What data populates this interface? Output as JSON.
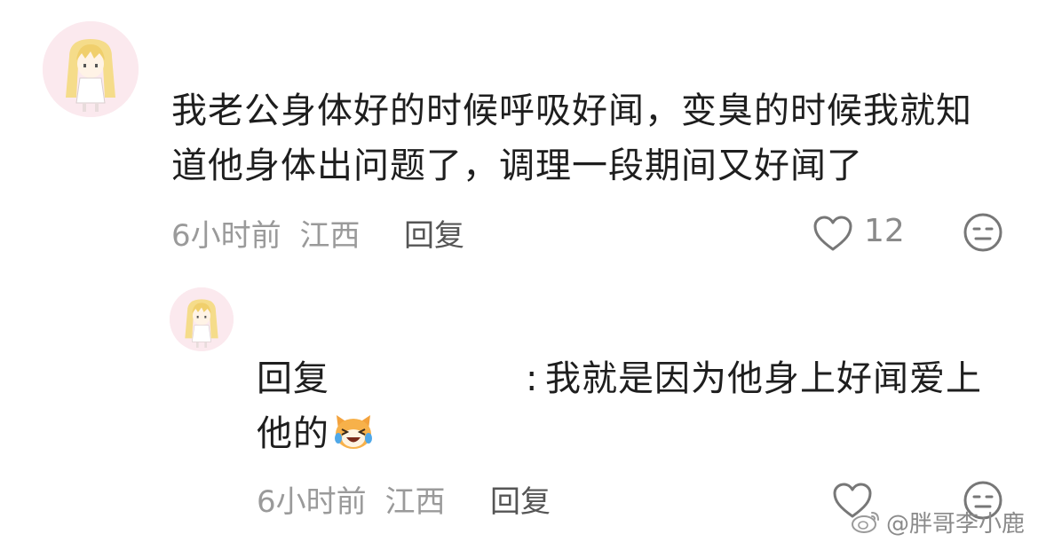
{
  "comment": {
    "text_line1": "我老公身体好的时候呼吸好闻，变臭的时候我就知",
    "text_line2": "道他身体出问题了，调理一段期间又好闻了",
    "time": "6小时前",
    "location": "江西",
    "reply_label": "回复",
    "like_count": "12"
  },
  "reply": {
    "prefix": "回复",
    "separator": ":",
    "text_line1": "我就是因为他身上好闻爱上",
    "text_line2": "他的",
    "time": "6小时前",
    "location": "江西",
    "reply_label": "回复"
  },
  "icons": {
    "like": "heart-outline-icon",
    "dislike": "meh-face-icon",
    "emoji": "crying-laughing-cat-emoji"
  },
  "watermark": {
    "text": "@胖哥李小鹿"
  },
  "colors": {
    "avatar_bg": "#fbe9ee",
    "meta_gray": "#9a9a9a",
    "text_dark": "#1e1e1e"
  }
}
